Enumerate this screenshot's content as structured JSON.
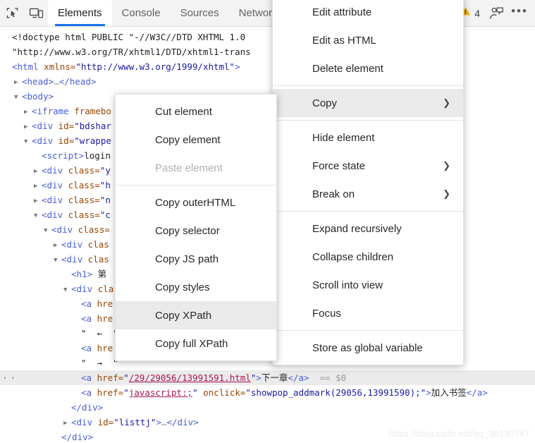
{
  "toolbar": {
    "inspect_icon": "inspect-element-icon",
    "device_icon": "device-toolbar-icon",
    "tabs": [
      {
        "label": "Elements",
        "active": true
      },
      {
        "label": "Console",
        "active": false
      },
      {
        "label": "Sources",
        "active": false
      },
      {
        "label": "Network",
        "active": false
      }
    ],
    "warning_icon": "warning-triangle-icon",
    "warning_count": "4",
    "feedback_icon": "feedback-person-icon",
    "more_label": "•••",
    "accent_color": "#1a73e8",
    "warning_color": "#f5b400",
    "background_color": "#f3f3f3"
  },
  "dom": {
    "rows": [
      {
        "indent": 0,
        "arrow": "",
        "segments": [
          {
            "t": "<!doctype html PUBLIC \"-//W3C//DTD XHTML 1.0 ",
            "c": "dtd"
          }
        ]
      },
      {
        "indent": 0,
        "arrow": "",
        "segments": [
          {
            "t": "\"http://www.w3.org/TR/xhtml1/DTD/xhtml1-trans",
            "c": "dtd"
          }
        ]
      },
      {
        "indent": 0,
        "arrow": "",
        "segments": [
          {
            "t": "<html ",
            "c": "tagb"
          },
          {
            "t": "xmlns=",
            "c": "attr"
          },
          {
            "t": "\"http://www.w3.org/1999/xhtml\"",
            "c": "val"
          },
          {
            "t": ">",
            "c": "tagb"
          }
        ]
      },
      {
        "indent": 1,
        "arrow": "▶",
        "segments": [
          {
            "t": "<head>",
            "c": "tagb"
          },
          {
            "t": "…",
            "c": "gray"
          },
          {
            "t": "</head>",
            "c": "tagb"
          }
        ]
      },
      {
        "indent": 1,
        "arrow": "▼",
        "segments": [
          {
            "t": "<body>",
            "c": "tagb"
          }
        ]
      },
      {
        "indent": 2,
        "arrow": "▶",
        "segments": [
          {
            "t": "<iframe ",
            "c": "tagb"
          },
          {
            "t": "framebo",
            "c": "attr"
          }
        ]
      },
      {
        "indent": 2,
        "arrow": "▶",
        "segments": [
          {
            "t": "<div ",
            "c": "tagb"
          },
          {
            "t": "id=",
            "c": "attr"
          },
          {
            "t": "\"bdshar",
            "c": "val"
          }
        ]
      },
      {
        "indent": 2,
        "arrow": "▼",
        "segments": [
          {
            "t": "<div ",
            "c": "tagb"
          },
          {
            "t": "id=",
            "c": "attr"
          },
          {
            "t": "\"wrappe",
            "c": "val"
          }
        ]
      },
      {
        "indent": 3,
        "arrow": "",
        "segments": [
          {
            "t": "<script>",
            "c": "tagb"
          },
          {
            "t": "login",
            "c": "plain"
          }
        ]
      },
      {
        "indent": 3,
        "arrow": "▶",
        "segments": [
          {
            "t": "<div ",
            "c": "tagb"
          },
          {
            "t": "class=",
            "c": "attr"
          },
          {
            "t": "\"y",
            "c": "val"
          }
        ]
      },
      {
        "indent": 3,
        "arrow": "▶",
        "segments": [
          {
            "t": "<div ",
            "c": "tagb"
          },
          {
            "t": "class=",
            "c": "attr"
          },
          {
            "t": "\"h",
            "c": "val"
          }
        ]
      },
      {
        "indent": 3,
        "arrow": "▶",
        "segments": [
          {
            "t": "<div ",
            "c": "tagb"
          },
          {
            "t": "class=",
            "c": "attr"
          },
          {
            "t": "\"n",
            "c": "val"
          }
        ]
      },
      {
        "indent": 3,
        "arrow": "▼",
        "segments": [
          {
            "t": "<div ",
            "c": "tagb"
          },
          {
            "t": "class=",
            "c": "attr"
          },
          {
            "t": "\"c",
            "c": "val"
          }
        ]
      },
      {
        "indent": 4,
        "arrow": "▼",
        "segments": [
          {
            "t": "<div ",
            "c": "tagb"
          },
          {
            "t": "class=",
            "c": "attr"
          }
        ]
      },
      {
        "indent": 5,
        "arrow": "▶",
        "segments": [
          {
            "t": "<div ",
            "c": "tagb"
          },
          {
            "t": "clas",
            "c": "attr"
          }
        ]
      },
      {
        "indent": 5,
        "arrow": "▼",
        "segments": [
          {
            "t": "<div ",
            "c": "tagb"
          },
          {
            "t": "clas",
            "c": "attr"
          }
        ]
      },
      {
        "indent": 6,
        "arrow": "",
        "segments": [
          {
            "t": "<h1> ",
            "c": "tagb"
          },
          {
            "t": "第",
            "c": "cjk"
          }
        ]
      },
      {
        "indent": 6,
        "arrow": "▼",
        "segments": [
          {
            "t": "<div ",
            "c": "tagb"
          },
          {
            "t": "cla",
            "c": "attr"
          }
        ]
      },
      {
        "indent": 7,
        "arrow": "",
        "segments": [
          {
            "t": "<a ",
            "c": "tagb"
          },
          {
            "t": "hre",
            "c": "attr"
          }
        ]
      },
      {
        "indent": 7,
        "arrow": "",
        "segments": [
          {
            "t": "<a ",
            "c": "tagb"
          },
          {
            "t": "hre",
            "c": "attr"
          }
        ]
      },
      {
        "indent": 7,
        "arrow": "",
        "segments": [
          {
            "t": "\"  ←  \"",
            "c": "plain"
          }
        ]
      },
      {
        "indent": 7,
        "arrow": "",
        "segments": [
          {
            "t": "<a ",
            "c": "tagb"
          },
          {
            "t": "hre",
            "c": "attr"
          }
        ]
      },
      {
        "indent": 7,
        "arrow": "",
        "segments": [
          {
            "t": "\"  →  \"",
            "c": "plain"
          }
        ]
      }
    ],
    "selected_row": {
      "indent": 7,
      "segments": [
        {
          "t": "<a ",
          "c": "tagb"
        },
        {
          "t": "href=",
          "c": "attr"
        },
        {
          "t": "\"",
          "c": "val"
        },
        {
          "t": "/29/29056/13991591.html",
          "c": "lnk"
        },
        {
          "t": "\"",
          "c": "val"
        },
        {
          "t": ">",
          "c": "tagb"
        },
        {
          "t": "下一章",
          "c": "cjk"
        },
        {
          "t": "</a>",
          "c": "tagb"
        },
        {
          "t": "  == $0",
          "c": "gray"
        }
      ]
    },
    "tail_rows": [
      {
        "indent": 7,
        "arrow": "",
        "segments": [
          {
            "t": "<a ",
            "c": "tagb"
          },
          {
            "t": "href=",
            "c": "attr"
          },
          {
            "t": "\"",
            "c": "val"
          },
          {
            "t": "javascript:;",
            "c": "lnk"
          },
          {
            "t": "\"",
            "c": "val"
          },
          {
            "t": " onclick=",
            "c": "attr"
          },
          {
            "t": "\"showpop_addmark(29056,13991590);\"",
            "c": "val"
          },
          {
            "t": ">",
            "c": "tagb"
          },
          {
            "t": "加入书签",
            "c": "cjk"
          },
          {
            "t": "</a>",
            "c": "tagb"
          }
        ]
      },
      {
        "indent": 6,
        "arrow": "",
        "segments": [
          {
            "t": "</div>",
            "c": "tagb"
          }
        ]
      },
      {
        "indent": 6,
        "arrow": "▶",
        "segments": [
          {
            "t": "<div ",
            "c": "tagb"
          },
          {
            "t": "id=",
            "c": "attr"
          },
          {
            "t": "\"listtj\"",
            "c": "val"
          },
          {
            "t": ">",
            "c": "tagb"
          },
          {
            "t": "…",
            "c": "gray"
          },
          {
            "t": "</div>",
            "c": "tagb"
          }
        ]
      },
      {
        "indent": 5,
        "arrow": "",
        "segments": [
          {
            "t": "</div>",
            "c": "tagb"
          }
        ]
      }
    ]
  },
  "context_menu": {
    "name": "element-context-menu",
    "items": [
      {
        "label": "Edit attribute",
        "submenu": false,
        "highlighted": false,
        "disabled": false
      },
      {
        "label": "Edit as HTML",
        "submenu": false,
        "highlighted": false,
        "disabled": false
      },
      {
        "label": "Delete element",
        "submenu": false,
        "highlighted": false,
        "disabled": false
      },
      {
        "separator": true
      },
      {
        "label": "Copy",
        "submenu": true,
        "highlighted": true,
        "disabled": false
      },
      {
        "separator": true
      },
      {
        "label": "Hide element",
        "submenu": false,
        "highlighted": false,
        "disabled": false
      },
      {
        "label": "Force state",
        "submenu": true,
        "highlighted": false,
        "disabled": false
      },
      {
        "label": "Break on",
        "submenu": true,
        "highlighted": false,
        "disabled": false
      },
      {
        "separator": true
      },
      {
        "label": "Expand recursively",
        "submenu": false,
        "highlighted": false,
        "disabled": false
      },
      {
        "label": "Collapse children",
        "submenu": false,
        "highlighted": false,
        "disabled": false
      },
      {
        "label": "Scroll into view",
        "submenu": false,
        "highlighted": false,
        "disabled": false
      },
      {
        "label": "Focus",
        "submenu": false,
        "highlighted": false,
        "disabled": false
      },
      {
        "separator": true
      },
      {
        "label": "Store as global variable",
        "submenu": false,
        "highlighted": false,
        "disabled": false
      }
    ],
    "submenu_chevron": "❯"
  },
  "copy_submenu": {
    "name": "copy-submenu",
    "items": [
      {
        "label": "Cut element",
        "highlighted": false,
        "disabled": false
      },
      {
        "label": "Copy element",
        "highlighted": false,
        "disabled": false
      },
      {
        "label": "Paste element",
        "highlighted": false,
        "disabled": true
      },
      {
        "separator": true
      },
      {
        "label": "Copy outerHTML",
        "highlighted": false,
        "disabled": false
      },
      {
        "label": "Copy selector",
        "highlighted": false,
        "disabled": false
      },
      {
        "label": "Copy JS path",
        "highlighted": false,
        "disabled": false
      },
      {
        "label": "Copy styles",
        "highlighted": false,
        "disabled": false
      },
      {
        "label": "Copy XPath",
        "highlighted": true,
        "disabled": false
      },
      {
        "label": "Copy full XPath",
        "highlighted": false,
        "disabled": false
      }
    ]
  },
  "watermark": {
    "text": "https://blog.csdn.net/qq_38130747"
  }
}
